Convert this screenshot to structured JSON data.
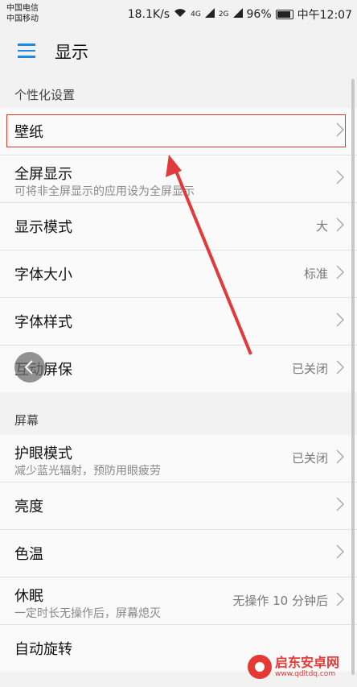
{
  "status_bar": {
    "carrier1": "中国电信",
    "carrier2": "中国移动",
    "speed": "18.1K/s",
    "net1": "4G",
    "net2": "2G",
    "battery": "96%",
    "time": "中午12:07"
  },
  "header": {
    "title": "显示"
  },
  "sections": [
    {
      "title": "个性化设置",
      "items": [
        {
          "label": "壁纸",
          "sub": "",
          "value": ""
        },
        {
          "label": "全屏显示",
          "sub": "可将非全屏显示的应用设为全屏显示",
          "value": ""
        },
        {
          "label": "显示模式",
          "sub": "",
          "value": "大"
        },
        {
          "label": "字体大小",
          "sub": "",
          "value": "标准"
        },
        {
          "label": "字体样式",
          "sub": "",
          "value": ""
        },
        {
          "label": "互动屏保",
          "sub": "",
          "value": "已关闭"
        }
      ]
    },
    {
      "title": "屏幕",
      "items": [
        {
          "label": "护眼模式",
          "sub": "减少蓝光辐射，预防用眼疲劳",
          "value": "已关闭"
        },
        {
          "label": "亮度",
          "sub": "",
          "value": ""
        },
        {
          "label": "色温",
          "sub": "",
          "value": ""
        },
        {
          "label": "休眠",
          "sub": "一定时长无操作后，屏幕熄灭",
          "value": "无操作 10 分钟后"
        },
        {
          "label": "自动旋转",
          "sub": "",
          "value": ""
        }
      ]
    }
  ],
  "watermark": {
    "name": "启东安卓网",
    "url": "www.qdltdq.com"
  },
  "colors": {
    "accent": "#1e88e5",
    "highlight": "#d23a2c"
  }
}
